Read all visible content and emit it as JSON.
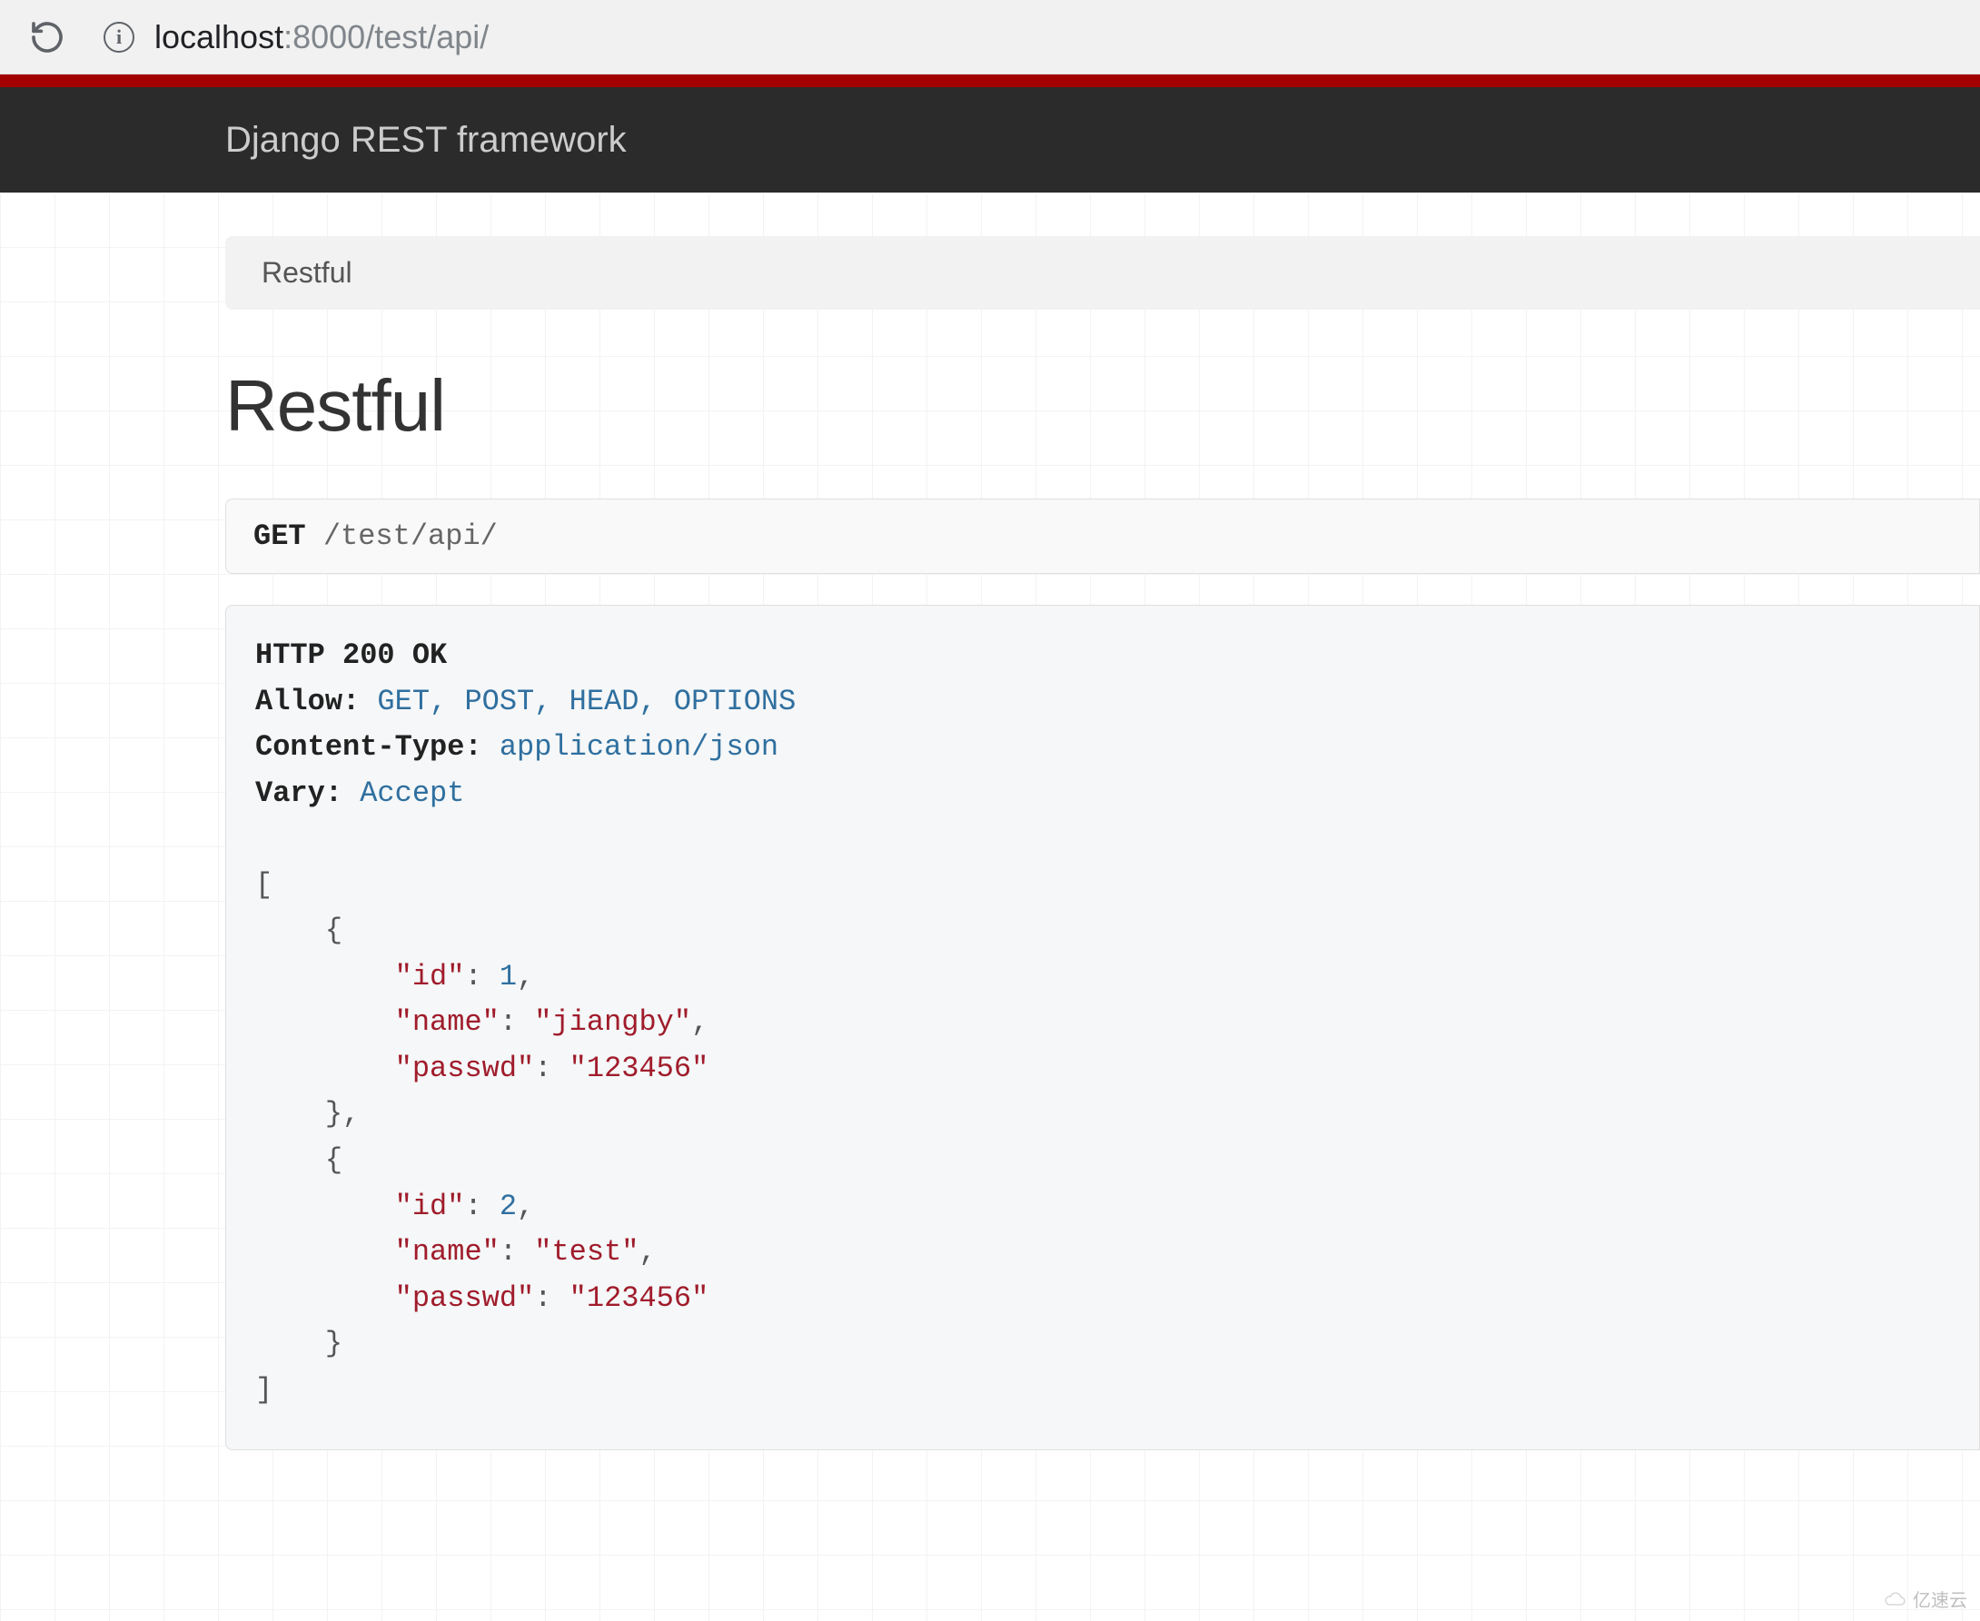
{
  "browser": {
    "url_host": "localhost",
    "url_port": ":8000",
    "url_path": "/test/api/"
  },
  "nav": {
    "brand": "Django REST framework"
  },
  "breadcrumb": {
    "items": [
      {
        "label": "Restful"
      }
    ]
  },
  "page": {
    "title": "Restful"
  },
  "request": {
    "method": "GET",
    "path": "/test/api/"
  },
  "response": {
    "status_line": "HTTP 200 OK",
    "headers": [
      {
        "key": "Allow:",
        "value": "GET, POST, HEAD, OPTIONS"
      },
      {
        "key": "Content-Type:",
        "value": "application/json"
      },
      {
        "key": "Vary:",
        "value": "Accept"
      }
    ],
    "body": [
      {
        "id": 1,
        "name": "jiangby",
        "passwd": "123456"
      },
      {
        "id": 2,
        "name": "test",
        "passwd": "123456"
      }
    ]
  },
  "watermark": {
    "text": "亿速云"
  }
}
